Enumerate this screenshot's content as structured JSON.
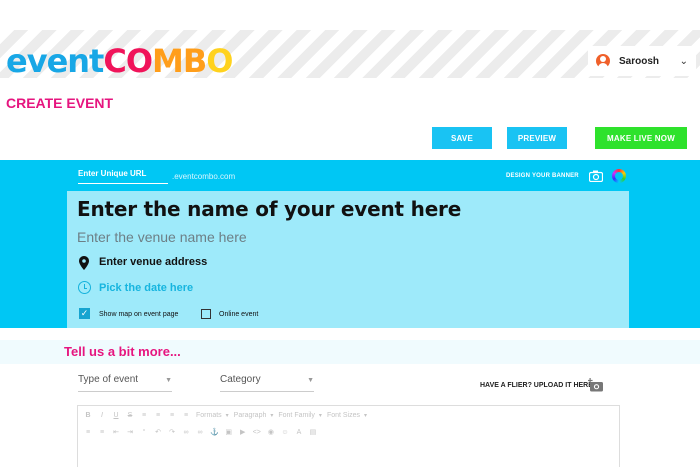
{
  "brand": {
    "logo_part1": "even",
    "logo_part2": "t",
    "logo_part3": "CO",
    "logo_part4": "MB",
    "logo_part5": "O"
  },
  "user": {
    "name": "Saroosh"
  },
  "page": {
    "title": "CREATE EVENT"
  },
  "actions": {
    "save": "SAVE",
    "preview": "PREVIEW",
    "live": "MAKE LIVE NOW"
  },
  "banner": {
    "url_placeholder": "Enter Unique URL",
    "url_suffix": ".eventcombo.com",
    "design_banner": "DESIGN YOUR BANNER",
    "event_name_placeholder": "Enter the name of your event here",
    "venue_name_placeholder": "Enter the venue name here",
    "venue_address_placeholder": "Enter venue address",
    "date_label": "Pick the date here",
    "show_map_label": "Show map on event page",
    "show_map_checked": true,
    "online_label": "Online event",
    "online_checked": false
  },
  "more": {
    "title": "Tell us a bit more...",
    "type_placeholder": "Type of event",
    "category_placeholder": "Category",
    "flier_label": "HAVE A FLIER? UPLOAD IT HERE"
  },
  "editor": {
    "format_dd": "Formats",
    "paragraph_dd": "Paragraph",
    "font_family_dd": "Font Family",
    "font_sizes_dd": "Font Sizes"
  },
  "colors": {
    "accent_cyan": "#00c7f4",
    "panel": "#9eeafa",
    "pink": "#e6157f",
    "green": "#2ee22c"
  }
}
